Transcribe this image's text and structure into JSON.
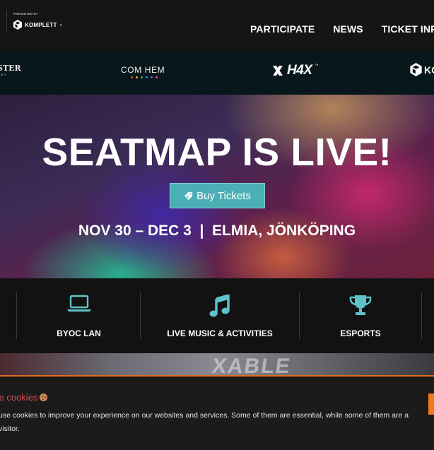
{
  "header": {
    "presented_by": "PRESENTED BY",
    "sponsor_name": "KOMPLETT",
    "sponsor_tm": "®",
    "nav": [
      "PARTICIPATE",
      "NEWS",
      "TICKET INFO"
    ]
  },
  "sponsors": {
    "monster": "STER",
    "monster_sub": "RGY",
    "comhem": "COM HEM",
    "comhem_dot_colors": [
      "#e8463d",
      "#f6a623",
      "#3fb54a",
      "#2d8fd8",
      "#9b59b6",
      "#e84393"
    ],
    "h4x": "H4X",
    "h4x_tm": "™",
    "komplett_partial": "KO"
  },
  "hero": {
    "title": "SEATMAP IS LIVE!",
    "cta_label": "Buy Tickets",
    "subtitle": "NOV 30 – DEC 3  |  ELMIA, JÖNKÖPING"
  },
  "features": [
    {
      "label": "BYOC LAN",
      "icon": "laptop-icon"
    },
    {
      "label": "LIVE MUSIC & ACTIVITIES",
      "icon": "music-note-icon"
    },
    {
      "label": "ESPORTS",
      "icon": "trophy-icon"
    }
  ],
  "photo": {
    "banner_text": "XABLE"
  },
  "cookie": {
    "title": "se cookies",
    "text": "use cookies to improve your experience on our websites and services. Some of them are essential, while some of them are a visitor."
  },
  "colors": {
    "accent_teal": "#4bb0b6",
    "icon_teal": "#5ec3c9",
    "cookie_orange": "#e46a1e",
    "cookie_title_red": "#d14f4f",
    "strip_bg": "#08171b"
  }
}
